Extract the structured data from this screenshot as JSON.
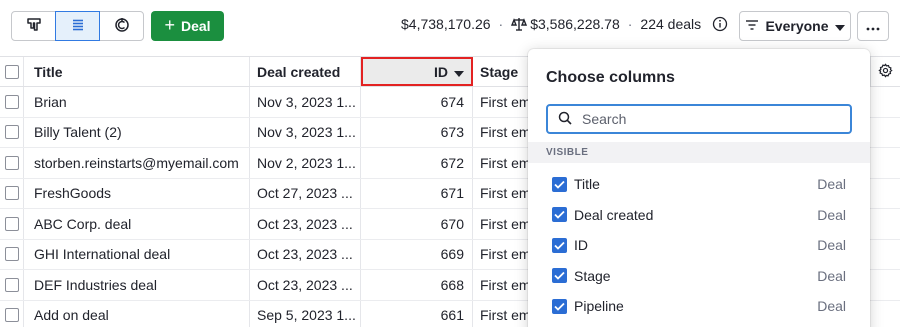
{
  "toolbar": {
    "views": [
      {
        "icon": "pipeline-board-icon",
        "active": false
      },
      {
        "icon": "list-view-icon",
        "active": true
      },
      {
        "icon": "forecast-icon",
        "active": false
      }
    ],
    "add_deal_label": "Deal",
    "total_value": "$4,738,170.26",
    "weighted_value": "$3,586,228.78",
    "deal_count": "224 deals",
    "filter_label": "Everyone"
  },
  "table": {
    "columns": [
      "Title",
      "Deal created",
      "ID",
      "Stage"
    ],
    "sorted_column": "ID",
    "sort_direction": "descending",
    "rows": [
      {
        "title": "Brian",
        "created": "Nov 3, 2023 1...",
        "id": "674",
        "stage": "First em"
      },
      {
        "title": "Billy Talent (2)",
        "created": "Nov 3, 2023 1...",
        "id": "673",
        "stage": "First em"
      },
      {
        "title": "storben.reinstarts@myemail.com",
        "created": "Nov 2, 2023 1...",
        "id": "672",
        "stage": "First em"
      },
      {
        "title": "FreshGoods",
        "created": "Oct 27, 2023 ...",
        "id": "671",
        "stage": "First em"
      },
      {
        "title": "ABC Corp. deal",
        "created": "Oct 23, 2023 ...",
        "id": "670",
        "stage": "First em"
      },
      {
        "title": "GHI International deal",
        "created": "Oct 23, 2023 ...",
        "id": "669",
        "stage": "First em"
      },
      {
        "title": "DEF Industries deal",
        "created": "Oct 23, 2023 ...",
        "id": "668",
        "stage": "First em"
      },
      {
        "title": "Add on deal",
        "created": "Sep 5, 2023 1...",
        "id": "661",
        "stage": "First em"
      }
    ]
  },
  "column_chooser": {
    "title": "Choose columns",
    "search_placeholder": "Search",
    "section_label": "VISIBLE",
    "options": [
      {
        "label": "Title",
        "group": "Deal",
        "checked": true
      },
      {
        "label": "Deal created",
        "group": "Deal",
        "checked": true
      },
      {
        "label": "ID",
        "group": "Deal",
        "checked": true
      },
      {
        "label": "Stage",
        "group": "Deal",
        "checked": true
      },
      {
        "label": "Pipeline",
        "group": "Deal",
        "checked": true
      }
    ]
  },
  "colors": {
    "accent": "#317ae2",
    "primary_button": "#1b8f3f",
    "highlight_outline": "#e32222",
    "checkbox": "#2b6dd4"
  }
}
